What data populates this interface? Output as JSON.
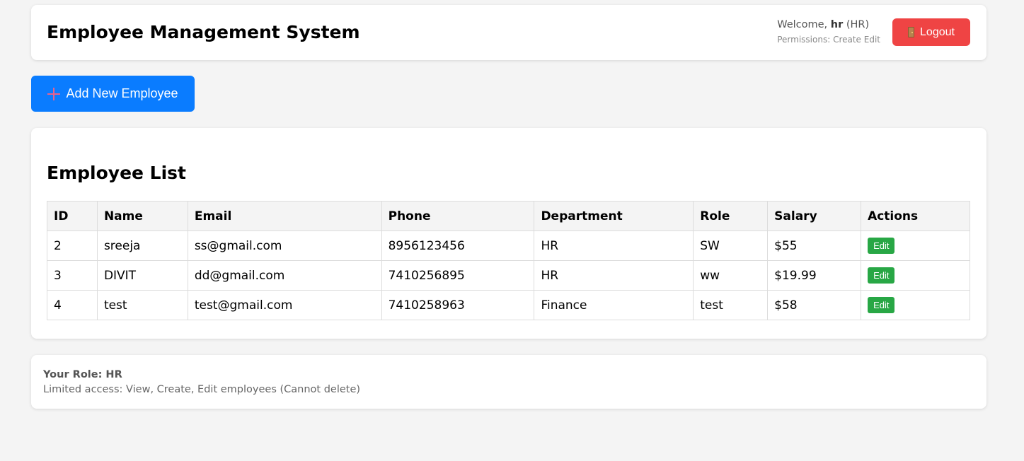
{
  "header": {
    "title": "Employee Management System",
    "welcome_prefix": "Welcome,",
    "username": "hr",
    "role_paren": "(HR)",
    "permissions": "Permissions: Create Edit",
    "logout_label": "Logout",
    "logout_icon": "door-icon"
  },
  "actions": {
    "add_label": "Add New Employee",
    "add_icon": "plus-icon"
  },
  "employee_list": {
    "title": "Employee List",
    "columns": [
      "ID",
      "Name",
      "Email",
      "Phone",
      "Department",
      "Role",
      "Salary",
      "Actions"
    ],
    "rows": [
      {
        "id": "2",
        "name": "sreeja",
        "email": "ss@gmail.com",
        "phone": "8956123456",
        "department": "HR",
        "role": "SW",
        "salary": "$55",
        "action": "Edit"
      },
      {
        "id": "3",
        "name": "DIVIT",
        "email": "dd@gmail.com",
        "phone": "7410256895",
        "department": "HR",
        "role": "ww",
        "salary": "$19.99",
        "action": "Edit"
      },
      {
        "id": "4",
        "name": "test",
        "email": "test@gmail.com",
        "phone": "7410258963",
        "department": "Finance",
        "role": "test",
        "salary": "$58",
        "action": "Edit"
      }
    ]
  },
  "role_info": {
    "title": "Your Role: HR",
    "description": "Limited access: View, Create, Edit employees (Cannot delete)"
  },
  "colors": {
    "logout": "#ef4444",
    "primary": "#0a7cff",
    "edit": "#28a745",
    "background": "#f4f4f4"
  }
}
